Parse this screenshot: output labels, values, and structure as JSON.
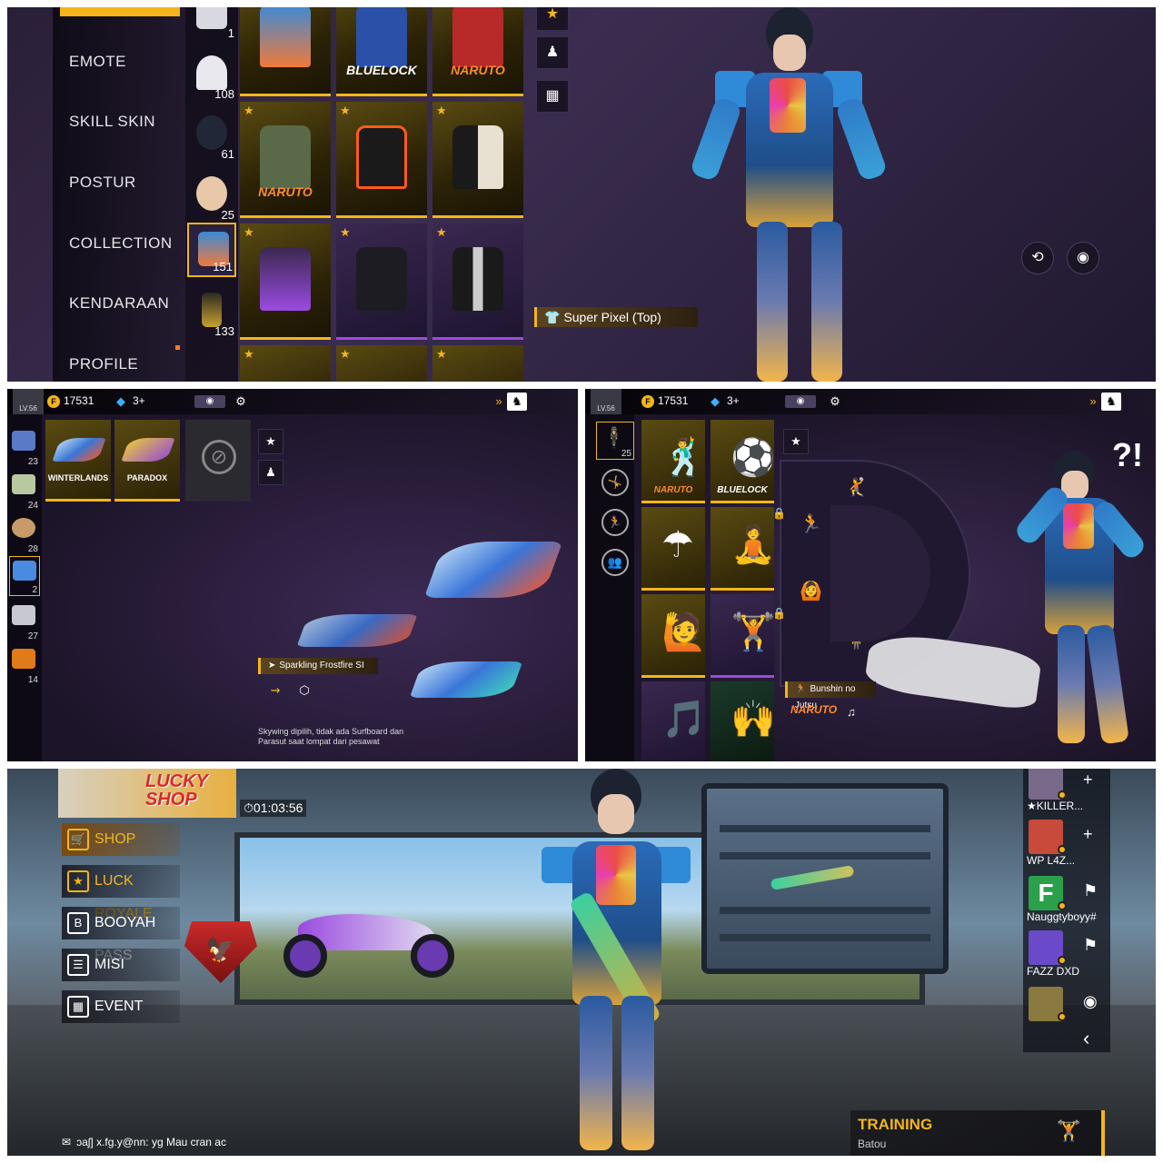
{
  "panel1": {
    "menu": [
      "EMOTE",
      "SKILL SKIN",
      "POSTUR",
      "COLLECTION",
      "KENDARAAN",
      "PROFILE"
    ],
    "categories": [
      {
        "count": "1",
        "icon": "figure-icon"
      },
      {
        "count": "108",
        "icon": "cap-icon"
      },
      {
        "count": "61",
        "icon": "hair-icon"
      },
      {
        "count": "25",
        "icon": "face-icon"
      },
      {
        "count": "151",
        "icon": "top-icon"
      },
      {
        "count": "133",
        "icon": "pants-icon"
      }
    ],
    "tiles": [
      {
        "brand": ""
      },
      {
        "brand": "BLUELOCK"
      },
      {
        "brand": "NARUTO"
      },
      {
        "brand": "NARUTO"
      },
      {
        "brand": ""
      },
      {
        "brand": ""
      },
      {
        "brand": ""
      },
      {
        "brand": ""
      },
      {
        "brand": ""
      }
    ],
    "selected_item": "Super Pixel (Top)"
  },
  "panel2": {
    "coins": "17531",
    "diamonds": "3+",
    "level": "LV.56",
    "side_counts": [
      "23",
      "24",
      "28",
      "2",
      "27",
      "14"
    ],
    "tiles": [
      "WINTERLANDS",
      "PARADOX",
      ""
    ],
    "selected_item": "Sparkling Frostfire SI",
    "caption": "Skywing dipilih, tidak ada Surfboard dan Parasut saat lompat dari pesawat"
  },
  "panel3": {
    "coins": "17531",
    "diamonds": "3+",
    "level": "LV.56",
    "side_count": "25",
    "tiles": [
      "NARUTO",
      "BLUELOCK",
      "",
      "",
      "",
      "",
      "",
      ""
    ],
    "selected_item": "Bunshin no Jutsu",
    "selected_brand": "NARUTO",
    "reaction": "?!"
  },
  "panel4": {
    "lucky_shop": "LUCKY SHOP",
    "timer": "01:03:56",
    "menu": [
      {
        "label": "SHOP",
        "icon": "cart-icon"
      },
      {
        "label": "LUCK ROYALE",
        "icon": "luck-icon"
      },
      {
        "label": "BOOYAH PASS",
        "icon": "pass-icon"
      },
      {
        "label": "MISI",
        "icon": "mission-icon"
      },
      {
        "label": "EVENT",
        "icon": "calendar-icon"
      }
    ],
    "friends": [
      {
        "name": "★KILLER...",
        "action": "+"
      },
      {
        "name": "WP    L4Z...",
        "action": "+"
      },
      {
        "name": "Nauggtyboyy#",
        "action": "⚑"
      },
      {
        "name": "FAZZ   DXD",
        "action": "⚑"
      },
      {
        "name": "",
        "action": "◉"
      }
    ],
    "mode_title": "TRAINING",
    "mode_map": "Batou",
    "chat": "ɔaʃ] x.fg.y@nn: yg Mau cran ac",
    "back": "‹"
  }
}
